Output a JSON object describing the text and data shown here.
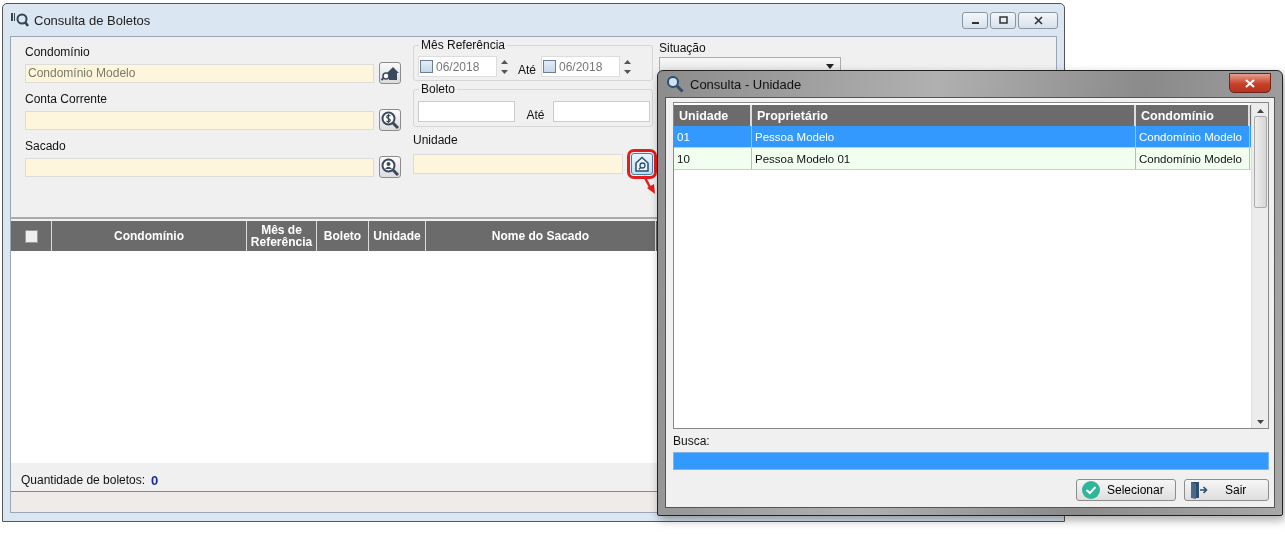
{
  "window": {
    "title": "Consulta de Boletos"
  },
  "filters": {
    "condominio": {
      "label": "Condomínio",
      "value": "Condomínio Modelo"
    },
    "conta_corrente": {
      "label": "Conta Corrente"
    },
    "sacado": {
      "label": "Sacado"
    },
    "mes_referencia": {
      "legend": "Mês Referência",
      "from": {
        "value": "06/2018",
        "checked": false
      },
      "to_label": "Até",
      "to": {
        "value": "06/2018",
        "checked": false
      }
    },
    "boleto": {
      "legend": "Boleto",
      "to_label": "Até"
    },
    "unidade": {
      "label": "Unidade"
    },
    "situacao": {
      "label": "Situação"
    }
  },
  "table": {
    "select_all_checked": false,
    "columns": [
      {
        "label": "Condomínio"
      },
      {
        "label": "Mês de Referência"
      },
      {
        "label": "Boleto"
      },
      {
        "label": "Unidade"
      },
      {
        "label": "Nome do Sacado"
      }
    ]
  },
  "footer": {
    "label": "Quantidade de boletos:",
    "count": "0"
  },
  "dialog": {
    "title": "Consulta - Unidade",
    "columns": [
      {
        "label": "Unidade"
      },
      {
        "label": "Proprietário"
      },
      {
        "label": "Condomínio"
      }
    ],
    "rows": [
      {
        "unidade": "01",
        "proprietario": "Pessoa Modelo",
        "condominio": "Condomínio Modelo",
        "selected": true
      },
      {
        "unidade": "10",
        "proprietario": "Pessoa Modelo 01",
        "condominio": "Condomínio Modelo",
        "selected": false
      }
    ],
    "search_label": "Busca:",
    "buttons": [
      {
        "label": "Selecionar",
        "kind": "select"
      },
      {
        "label": "Sair",
        "kind": "exit"
      }
    ]
  }
}
